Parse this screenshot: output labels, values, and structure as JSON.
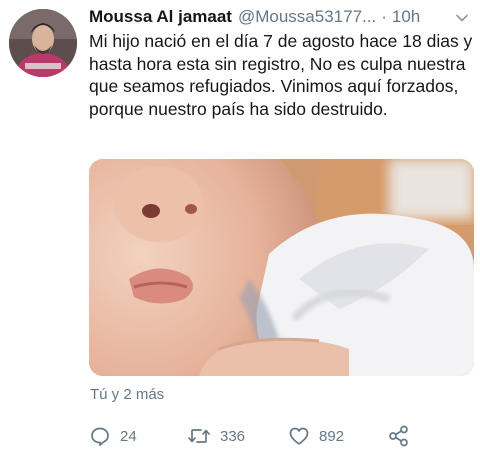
{
  "tweet": {
    "author_name": "Moussa Al jamaat",
    "handle": "@Moussa53177...",
    "separator": "·",
    "time": "10h",
    "text": "Mi hijo nació en el día 7 de agosto hace 18 dias y hasta hora esta sin registro, No es culpa nuestra que seamos refugiados. Vinimos aquí forzados, porque nuestro país ha sido destruido.",
    "social_context": "Tú y 2 más",
    "replies": "24",
    "retweets": "336",
    "likes": "892"
  },
  "icons": {
    "reply": "speech-bubble-icon",
    "retweet": "retweet-arrows-icon",
    "like": "heart-icon",
    "share": "share-nodes-icon",
    "more": "chevron-down-icon"
  },
  "colors": {
    "text": "#14171a",
    "secondary": "#657786",
    "background": "#ffffff"
  }
}
